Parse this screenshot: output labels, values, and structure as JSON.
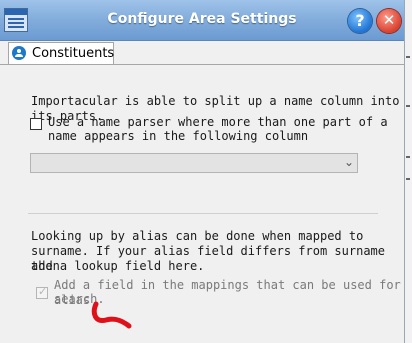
{
  "window": {
    "title": "Configure Area Settings",
    "help_glyph": "?",
    "close_glyph": "✕"
  },
  "tabs": [
    {
      "label": "Constituents",
      "icon": "person-icon",
      "selected": true
    }
  ],
  "section1": {
    "description": "Importacular is able to split up a name column into its parts.",
    "checkbox_line1": "Use a name parser where more than one part of a",
    "checkbox_line2": "name appears in the following column",
    "checkbox_checked": false,
    "dropdown_value": ""
  },
  "section2": {
    "line1": "Looking up by alias can be done when mapped to",
    "line2": "surname. If your alias field differs from surname then",
    "line3": "add a lookup field here.",
    "checkbox_line1": "Add a field in the mappings that can be used for alias",
    "checkbox_line2": "search.",
    "checkbox_checked": true,
    "checkbox_enabled": false
  },
  "colors": {
    "titlebar": "#82acdb",
    "panel": "#f0f0f0",
    "annotation": "#e0101a"
  }
}
